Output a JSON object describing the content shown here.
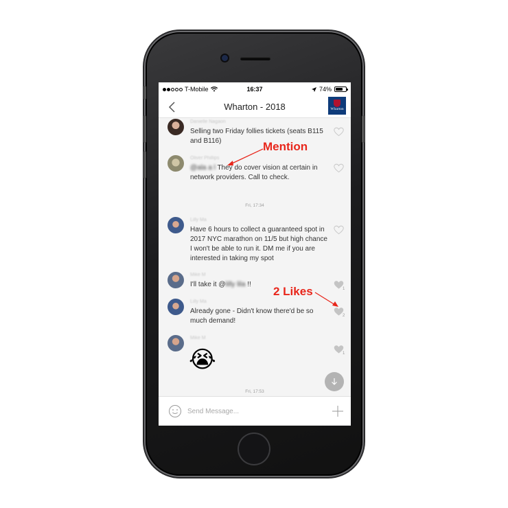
{
  "status_bar": {
    "carrier": "T-Mobile",
    "time": "16:37",
    "battery": "74%",
    "battery_level": 0.74
  },
  "nav": {
    "title": "Wharton - 2018",
    "logo_text": "Wharton"
  },
  "messages": [
    {
      "name": "Danielle Nagaon",
      "text": "Selling two Friday follies tickets (seats B115 and B116)",
      "likes": ""
    },
    {
      "name": "Oliver Phillips",
      "mention": "@ala a l",
      "text": " They do cover vision at certain in network providers. Call to check.",
      "likes": ""
    },
    {
      "name": "Lilly Ma",
      "text": "Have 6 hours to collect a guaranteed spot in 2017 NYC marathon on 11/5 but high chance I won't be able to run it. DM me if you are interested in taking my spot",
      "likes": ""
    },
    {
      "name": "Mike M",
      "text_before": "I'll take it @",
      "mention": "lilly lila",
      "text_after": " !!",
      "likes": "1"
    },
    {
      "name": "Lilly Ma",
      "text": "Already gone - Didn't know there'd be so much demand!",
      "likes": "2"
    },
    {
      "name": "Mike M",
      "emoji": "😭",
      "likes": "1"
    }
  ],
  "time_separators": [
    "Fri, 17:34",
    "Fri, 17:53"
  ],
  "composer": {
    "placeholder": "Send Message..."
  },
  "annotations": {
    "mention": "Mention",
    "likes": "2 Likes"
  },
  "colors": {
    "annotation": "#e8261b",
    "nav_logo_bg": "#0e3b7a",
    "screen_bg": "#f4f4f4"
  }
}
